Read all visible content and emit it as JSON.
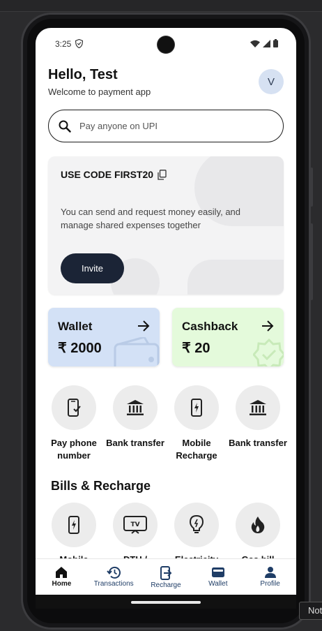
{
  "status": {
    "time": "3:25"
  },
  "header": {
    "greeting": "Hello, Test",
    "subtitle": "Welcome to payment app",
    "avatar_initial": "V"
  },
  "search": {
    "placeholder": "Pay anyone on UPI"
  },
  "promo": {
    "code_label": "USE CODE FIRST20",
    "description": "You can send and request money easily, and manage shared expenses together",
    "invite_label": "Invite"
  },
  "cards": {
    "wallet": {
      "title": "Wallet",
      "value": "₹ 2000",
      "color": "#d3e1f6"
    },
    "cashback": {
      "title": "Cashback",
      "value": "₹ 20",
      "color": "#e4fadb"
    }
  },
  "quick_actions": [
    {
      "label": "Pay phone number",
      "icon": "phone-check-icon"
    },
    {
      "label": "Bank transfer",
      "icon": "bank-icon"
    },
    {
      "label": "Mobile Recharge",
      "icon": "phone-bolt-icon"
    },
    {
      "label": "Bank transfer",
      "icon": "bank-icon"
    }
  ],
  "bills": {
    "title": "Bills & Recharge",
    "items": [
      {
        "label": "Mobile",
        "icon": "phone-bolt-icon"
      },
      {
        "label": "DTH /",
        "icon": "tv-icon"
      },
      {
        "label": "Electricity",
        "icon": "bulb-icon"
      },
      {
        "label": "Gas bill",
        "icon": "flame-icon"
      }
    ]
  },
  "nav": {
    "items": [
      {
        "label": "Home",
        "icon": "home-icon",
        "active": true
      },
      {
        "label": "Transactions",
        "icon": "history-icon",
        "active": false
      },
      {
        "label": "Recharge",
        "icon": "recharge-icon",
        "active": false
      },
      {
        "label": "Wallet",
        "icon": "wallet-icon",
        "active": false
      },
      {
        "label": "Profile",
        "icon": "person-icon",
        "active": false
      }
    ]
  },
  "tooltip": {
    "text": "Not"
  }
}
